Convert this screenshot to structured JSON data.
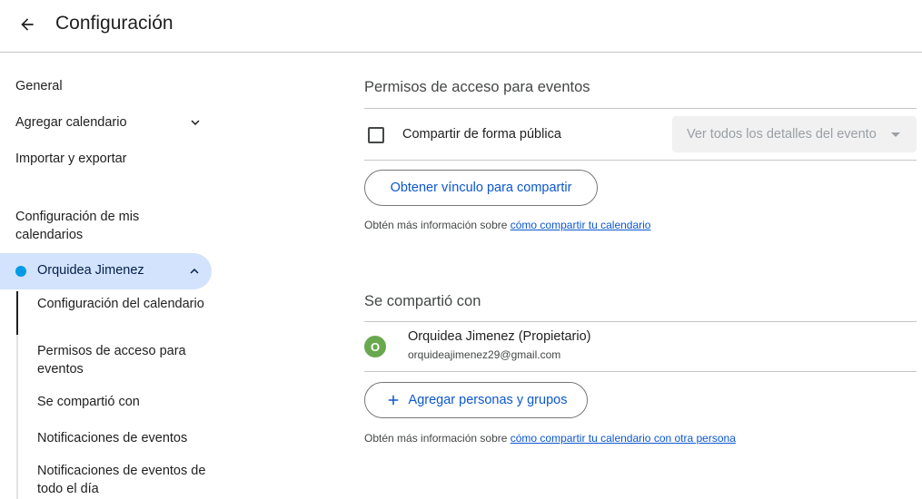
{
  "header": {
    "title": "Configuración"
  },
  "sidebar": {
    "general": "General",
    "add_calendar": "Agregar calendario",
    "import_export": "Importar y exportar",
    "my_calendars_heading": "Configuración de mis calendarios",
    "calendar": {
      "name": "Orquidea Jimenez",
      "color": "#039be5"
    },
    "sub_items": [
      "Configuración del calendario",
      "Permisos de acceso para eventos",
      "Se compartió con",
      "Notificaciones de eventos",
      "Notificaciones de eventos de todo el día"
    ]
  },
  "access": {
    "title": "Permisos de acceso para eventos",
    "share_public_label": "Compartir de forma pública",
    "share_public_checked": false,
    "detail_select": "Ver todos los detalles del evento",
    "get_link_button": "Obtener vínculo para compartir",
    "info_prefix": "Obtén más información sobre ",
    "info_link": "cómo compartir tu calendario"
  },
  "shared": {
    "title": "Se compartió con",
    "person": {
      "avatar_letter": "O",
      "avatar_color": "#6aa84f",
      "name": "Orquidea Jimenez (Propietario)",
      "email": "orquideajimenez29@gmail.com"
    },
    "add_button": "Agregar personas y grupos",
    "info_prefix": "Obtén más información sobre ",
    "info_link": "cómo compartir tu calendario con otra persona"
  },
  "icons": {
    "back": "arrow-back-icon",
    "expand": "chevron-down-icon",
    "collapse": "chevron-up-icon",
    "add": "plus-icon"
  }
}
